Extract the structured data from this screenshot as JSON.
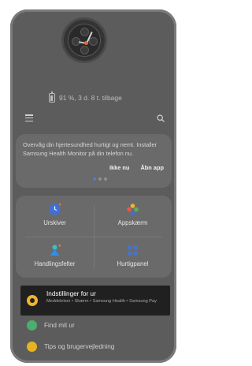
{
  "battery": {
    "text": "91 %, 3 d. 8 t. tilbage"
  },
  "health_card": {
    "text": "Overvåg din hjertesundhed hurtigt og nemt. Installer Samsung Health Monitor på din telefon nu.",
    "dismiss_label": "Ikke nu",
    "open_label": "Åbn app"
  },
  "grid": {
    "items": [
      {
        "label": "Urskiver",
        "icon": "watch-faces-icon",
        "color": "#3f6fd8"
      },
      {
        "label": "Appskærm",
        "icon": "apps-screen-icon",
        "color": "#58b05c"
      },
      {
        "label": "Handlingsfelter",
        "icon": "tiles-icon",
        "color": "#2f8ff0"
      },
      {
        "label": "Hurtigpanel",
        "icon": "quick-panel-icon",
        "color": "#4a72c8"
      }
    ]
  },
  "settings": {
    "title": "Indstillinger for ur",
    "subtitle": "Meddelelser • Skærm • Samsung Health • Samsung Pay",
    "color": "#f0b429"
  },
  "list": [
    {
      "label": "Find mit ur",
      "icon": "find-watch-icon",
      "color": "#4cae6e"
    },
    {
      "label": "Tips og brugervejledning",
      "icon": "tips-icon",
      "color": "#e6b422"
    }
  ]
}
